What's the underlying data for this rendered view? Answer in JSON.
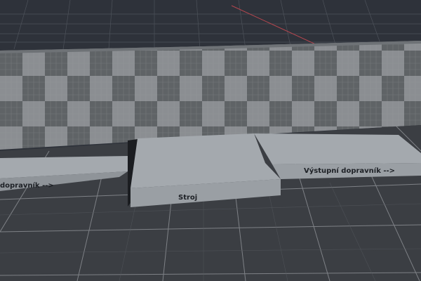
{
  "scene": {
    "labels": {
      "input_conveyor": "dopravník -->",
      "machine": "Stroj",
      "output_conveyor": "Výstupní dopravník -->"
    },
    "colors": {
      "sky": "#2e323a",
      "floor": "#3b3e43",
      "grid_line": "#8a8d92",
      "checker_light": "#8b8e92",
      "checker_dark": "#5f6366",
      "platform_top": "#a4a9ae",
      "platform_side": "#8f9499",
      "axis_red": "#b5474f"
    }
  }
}
